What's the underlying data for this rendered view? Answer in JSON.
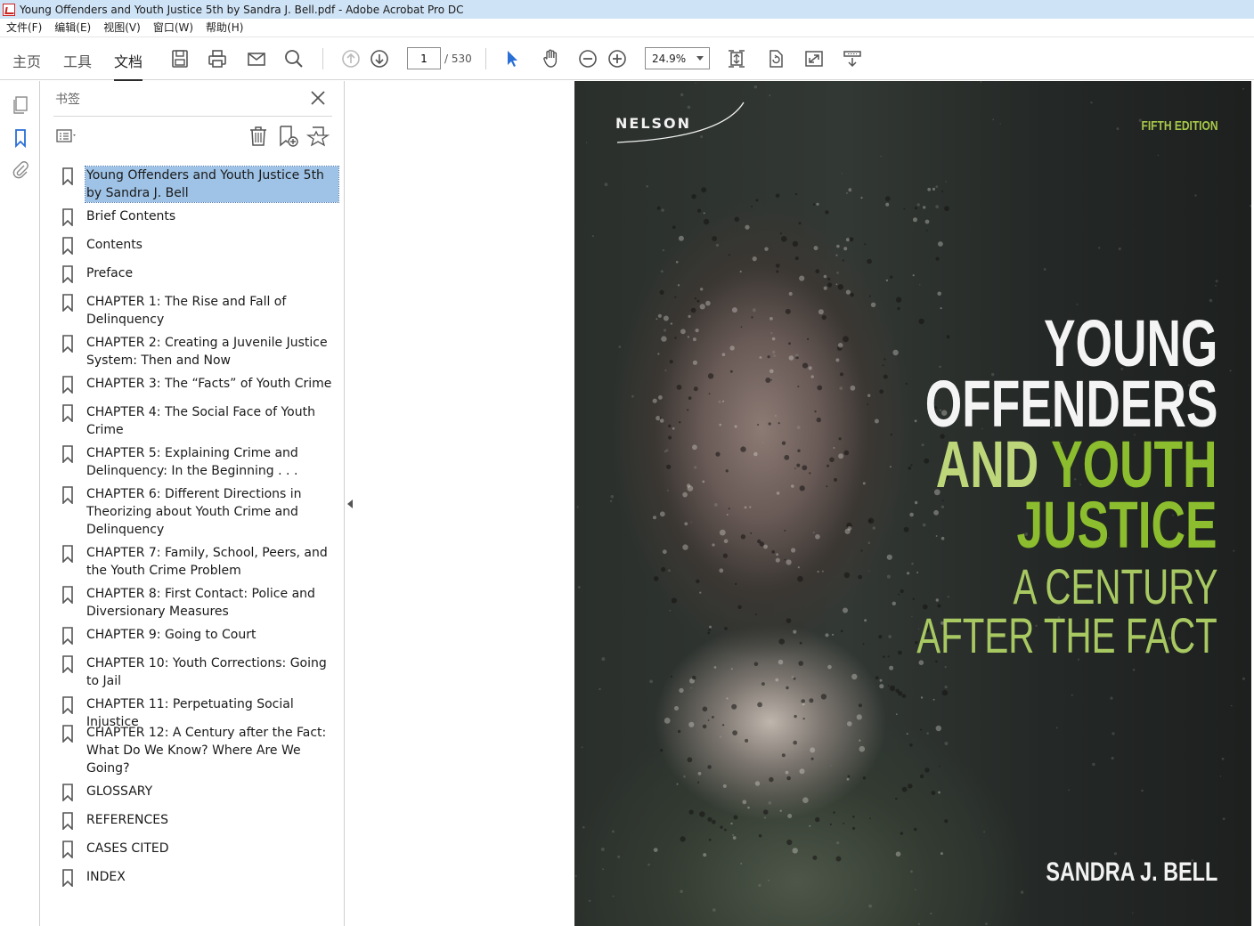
{
  "window": {
    "title": "Young Offenders and Youth Justice 5th by Sandra J. Bell.pdf - Adobe Acrobat Pro DC"
  },
  "menu": [
    "文件(F)",
    "编辑(E)",
    "视图(V)",
    "窗口(W)",
    "帮助(H)"
  ],
  "toolbar": {
    "tabs": [
      "主页",
      "工具",
      "文档"
    ],
    "active_tab": "文档",
    "page_current": "1",
    "page_total": "/ 530",
    "zoom": "24.9%",
    "icons": [
      "save-icon",
      "print-icon",
      "email-icon",
      "search-icon",
      "page-up-icon",
      "page-down-icon",
      "select-cursor-icon",
      "hand-icon",
      "zoom-out-icon",
      "zoom-in-icon",
      "fit-page-icon",
      "rotate-icon",
      "full-screen-icon",
      "read-mode-icon"
    ]
  },
  "rail": {
    "icons": [
      "pages-icon",
      "bookmark-icon",
      "attachment-icon"
    ]
  },
  "bookmarks": {
    "title": "书签",
    "items": [
      {
        "label": "Young Offenders and Youth Justice 5th by Sandra J. Bell",
        "selected": true
      },
      {
        "label": "Brief Contents"
      },
      {
        "label": "Contents"
      },
      {
        "label": "Preface"
      },
      {
        "label": "CHAPTER 1: The Rise and Fall of Delinquency"
      },
      {
        "label": "CHAPTER 2: Creating a Juvenile Justice System: Then and Now"
      },
      {
        "label": "CHAPTER 3: The “Facts” of Youth Crime"
      },
      {
        "label": "CHAPTER 4: The Social Face of Youth Crime"
      },
      {
        "label": "CHAPTER 5: Explaining Crime and Delinquency: In the Beginning . . ."
      },
      {
        "label": "CHAPTER 6: Different Directions in Theorizing about Youth Crime and Delinquency"
      },
      {
        "label": "CHAPTER 7: Family, School, Peers, and the Youth Crime Problem"
      },
      {
        "label": "CHAPTER 8: First Contact: Police and Diversionary Measures"
      },
      {
        "label": "CHAPTER 9: Going to Court"
      },
      {
        "label": "CHAPTER 10: Youth Corrections: Going to Jail"
      },
      {
        "label": "CHAPTER 11: Perpetuating Social Injustice"
      },
      {
        "label": "CHAPTER 12: A Century after the Fact: What Do We Know? Where Are We Going?"
      },
      {
        "label": "GLOSSARY"
      },
      {
        "label": "REFERENCES"
      },
      {
        "label": "CASES CITED"
      },
      {
        "label": "INDEX"
      }
    ]
  },
  "cover": {
    "publisher": "NELSON",
    "edition": "FIFTH EDITION",
    "title_line1": "YOUNG",
    "title_line2": "OFFENDERS",
    "title_line3a": "AND",
    "title_line3b": "YOUTH",
    "title_line4": "JUSTICE",
    "subtitle_line1": "A CENTURY",
    "subtitle_line2": "AFTER THE FACT",
    "author": "SANDRA J. BELL",
    "colors": {
      "accent_green": "#8cbd2e",
      "light_green": "#bdd67a",
      "sub_green": "#a8c862"
    }
  }
}
